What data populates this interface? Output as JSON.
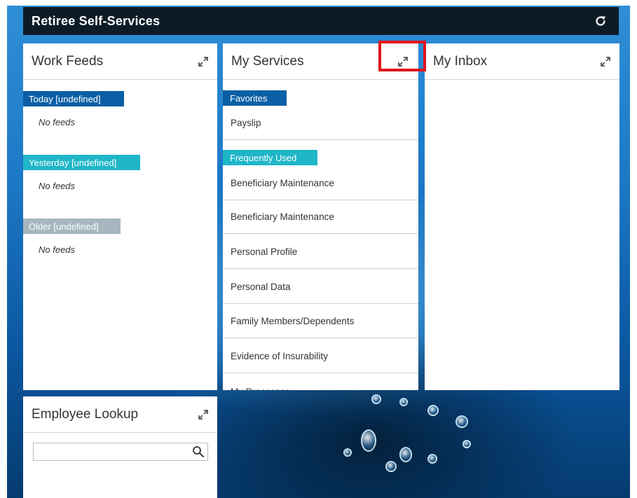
{
  "header": {
    "title": "Retiree Self-Services",
    "refresh_icon": "refresh-icon"
  },
  "work_feeds": {
    "title": "Work Feeds",
    "expand_icon": "expand-icon",
    "sections": [
      {
        "label": "Today [undefined]",
        "empty_text": "No feeds",
        "color": "#0a5fa5"
      },
      {
        "label": "Yesterday [undefined]",
        "empty_text": "No feeds",
        "color": "#1fb6c8"
      },
      {
        "label": "Older [undefined]",
        "empty_text": "No feeds",
        "color": "#a6b7bf"
      }
    ]
  },
  "my_services": {
    "title": "My Services",
    "expand_icon": "expand-icon",
    "favorites_label": "Favorites",
    "favorites_color": "#0a5fa5",
    "favorites": [
      "Payslip"
    ],
    "frequent_label": "Frequently Used",
    "frequent_color": "#1fb6c8",
    "frequent": [
      "Beneficiary Maintenance",
      "Beneficiary Maintenance",
      "Personal Profile",
      "Personal Data",
      "Family Members/Dependents",
      "Evidence of Insurability",
      "My Processes"
    ]
  },
  "my_inbox": {
    "title": "My Inbox",
    "expand_icon": "expand-icon"
  },
  "employee_lookup": {
    "title": "Employee Lookup",
    "expand_icon": "expand-icon",
    "search_value": "",
    "search_placeholder": "",
    "search_icon": "search-icon"
  },
  "colors": {
    "header_bg": "#0d1b26",
    "highlight": "#e2141b"
  }
}
